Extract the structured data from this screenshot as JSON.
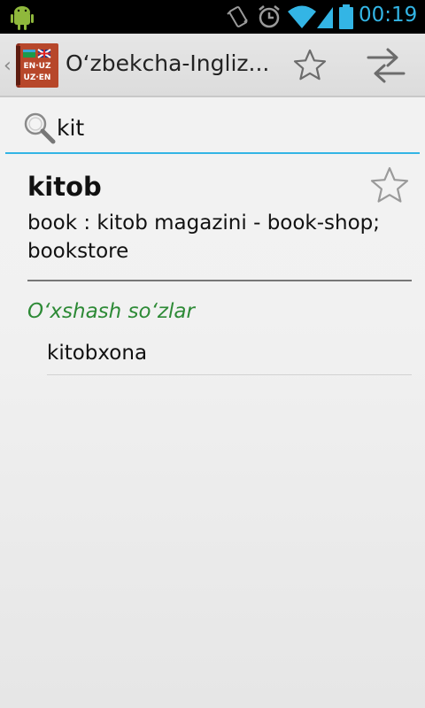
{
  "status_bar": {
    "time": "00:19",
    "icons": [
      "android-icon",
      "vibrate-icon",
      "alarm-icon",
      "wifi-icon",
      "signal-icon",
      "battery-icon"
    ],
    "accent_color": "#33b5e5"
  },
  "action_bar": {
    "title": "Oʻzbekcha-Ingliz...",
    "logo": {
      "top": "EN·UZ",
      "bottom": "UZ·EN"
    },
    "icons": [
      "star-outline-icon",
      "swap-icon"
    ]
  },
  "search": {
    "value": "kit",
    "accent_color": "#33b5e5"
  },
  "entry": {
    "word": "kitob",
    "definition": "book : kitob magazini - book-shop; bookstore"
  },
  "similar": {
    "heading": "Oʻxshash soʻzlar",
    "heading_color": "#2d8a36",
    "items": [
      {
        "label": "kitobxona"
      }
    ]
  }
}
